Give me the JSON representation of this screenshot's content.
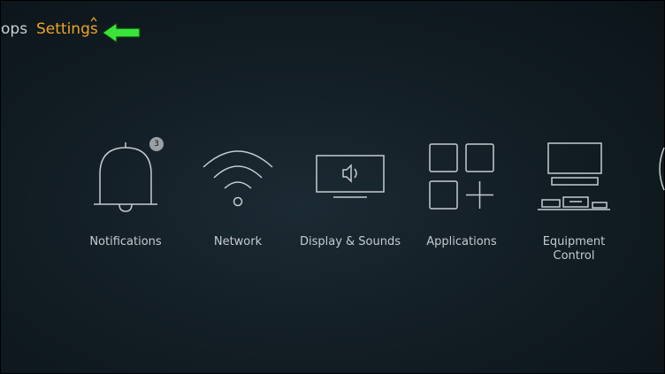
{
  "nav": {
    "previous_label": "ops",
    "current_label": "Settings"
  },
  "tiles": [
    {
      "label": "Notifications",
      "badge": "3",
      "icon": "bell-icon"
    },
    {
      "label": "Network",
      "icon": "wifi-icon"
    },
    {
      "label": "Display & Sounds",
      "icon": "display-sound-icon"
    },
    {
      "label": "Applications",
      "icon": "applications-icon"
    },
    {
      "label": "Equipment\nControl",
      "icon": "equipment-control-icon"
    }
  ],
  "colors": {
    "accent": "#f0a524",
    "icon_stroke": "#c4ccd1",
    "annotation_arrow": "#39e33a"
  }
}
